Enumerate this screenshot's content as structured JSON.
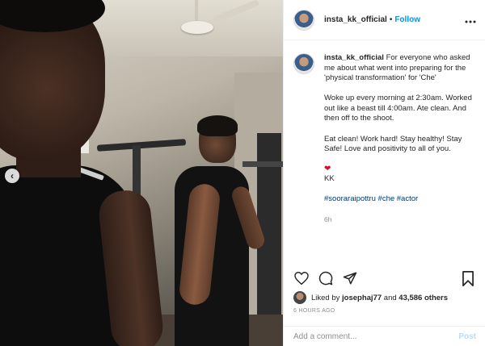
{
  "post": {
    "username": "insta_kk_official",
    "follow_label": "Follow",
    "separator": "•",
    "more_icon": "more-horizontal-icon"
  },
  "caption": {
    "username": "insta_kk_official",
    "intro": "For everyone who asked me about what went into preparing for the 'physical transformation' for 'Che'",
    "routine": "Woke up every morning at 2:30am. Worked out like a beast till 4:00am. Ate clean. And then off to the shoot.",
    "message": "Eat clean! Work hard! Stay healthy! Stay Safe! Love and positivity to all of you.",
    "heart": "❤",
    "signoff": "KK",
    "hashtags": "#sooraraipottru #che #actor",
    "time_ago": "6h"
  },
  "actions": {
    "like_icon": "heart-icon",
    "comment_icon": "comment-icon",
    "share_icon": "share-icon",
    "save_icon": "bookmark-icon"
  },
  "likes": {
    "prefix": "Liked by",
    "liker": "josephaj77",
    "conjunction": "and",
    "others": "43,586 others"
  },
  "posted_time": "6 HOURS AGO",
  "comment": {
    "placeholder": "Add a comment...",
    "post_label": "Post"
  },
  "carousel": {
    "prev_label": "‹"
  },
  "colors": {
    "link_blue": "#0095f6",
    "hashtag_blue": "#00376b",
    "muted": "#8e8e8e",
    "post_disabled": "#b2dffc"
  }
}
